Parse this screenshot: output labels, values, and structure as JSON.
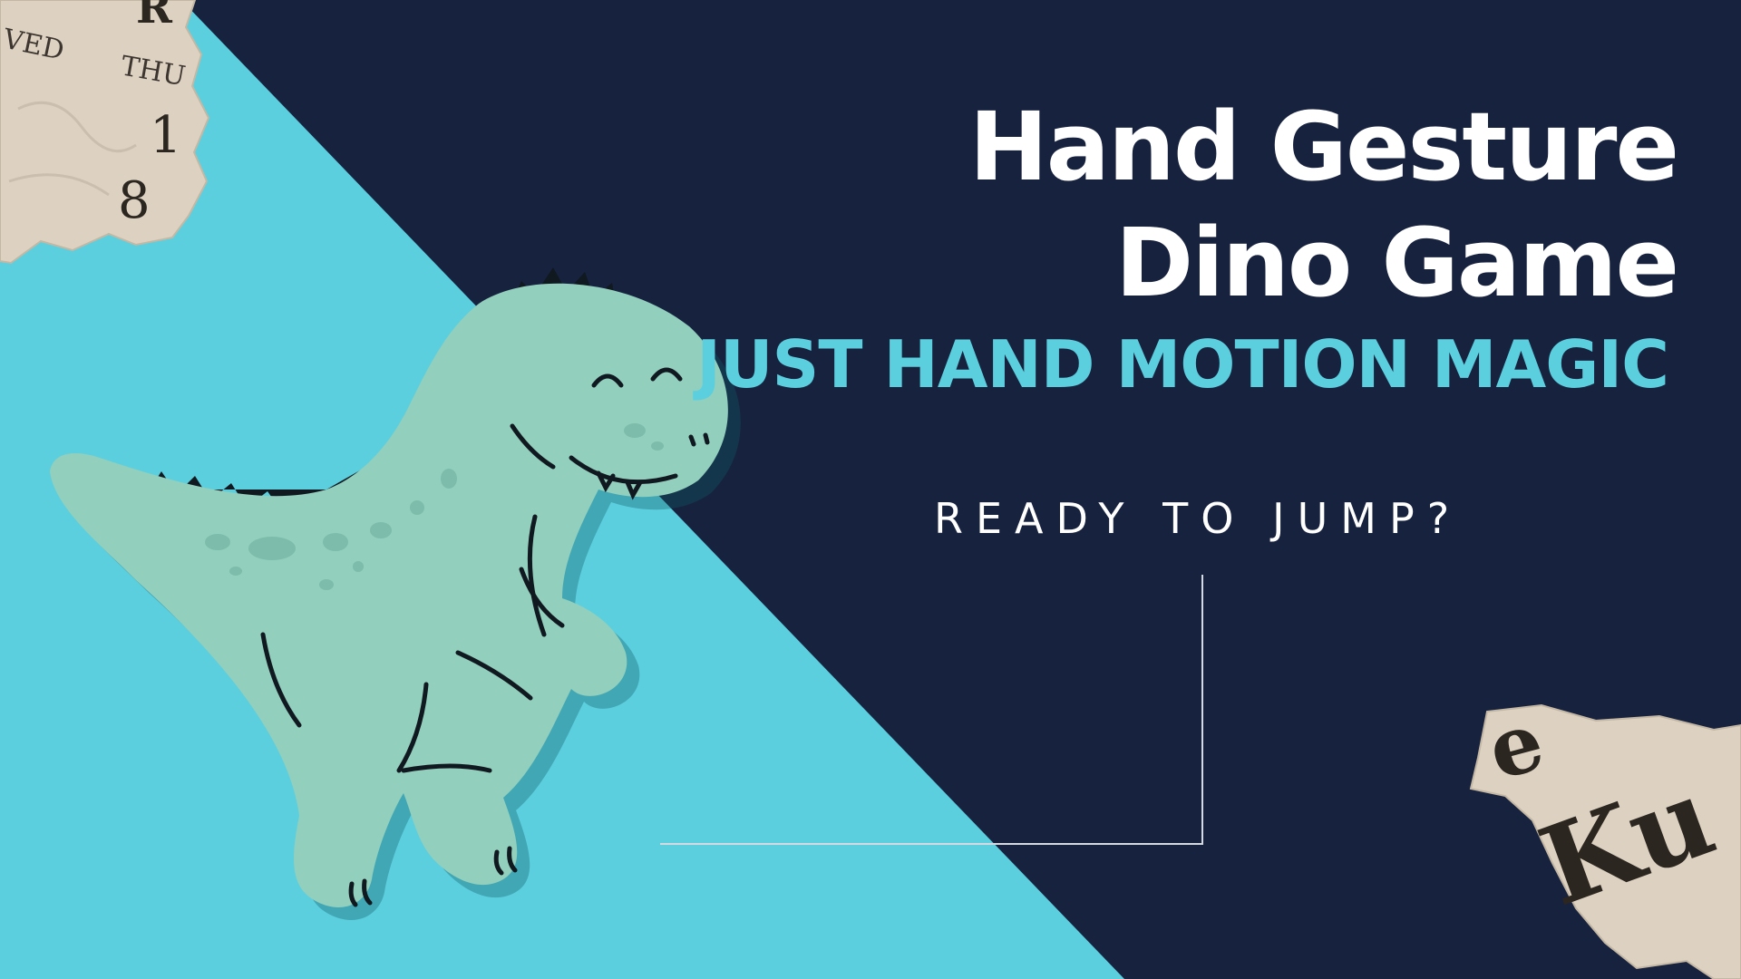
{
  "banner": {
    "title_line1": "Hand Gesture",
    "title_line2": "Dino Game",
    "subtitle": "JUST HAND MOTION MAGIC",
    "call_to_action": "READY TO JUMP?"
  },
  "paper_scraps": {
    "top_left_text": [
      "VED",
      "R",
      "THU",
      "1",
      "8"
    ],
    "bottom_right_text": [
      "e",
      "Ku"
    ]
  },
  "colors": {
    "background_navy": "#17223f",
    "diagonal_cyan": "#5ccfdf",
    "title_white": "#ffffff",
    "subtitle_cyan": "#5ccfdf",
    "dino_green": "#92cfbc",
    "paper_beige": "#ddd2c1"
  },
  "icons": {
    "mascot": "dinosaur-illustration",
    "decoration": "torn-newspaper-scraps"
  }
}
